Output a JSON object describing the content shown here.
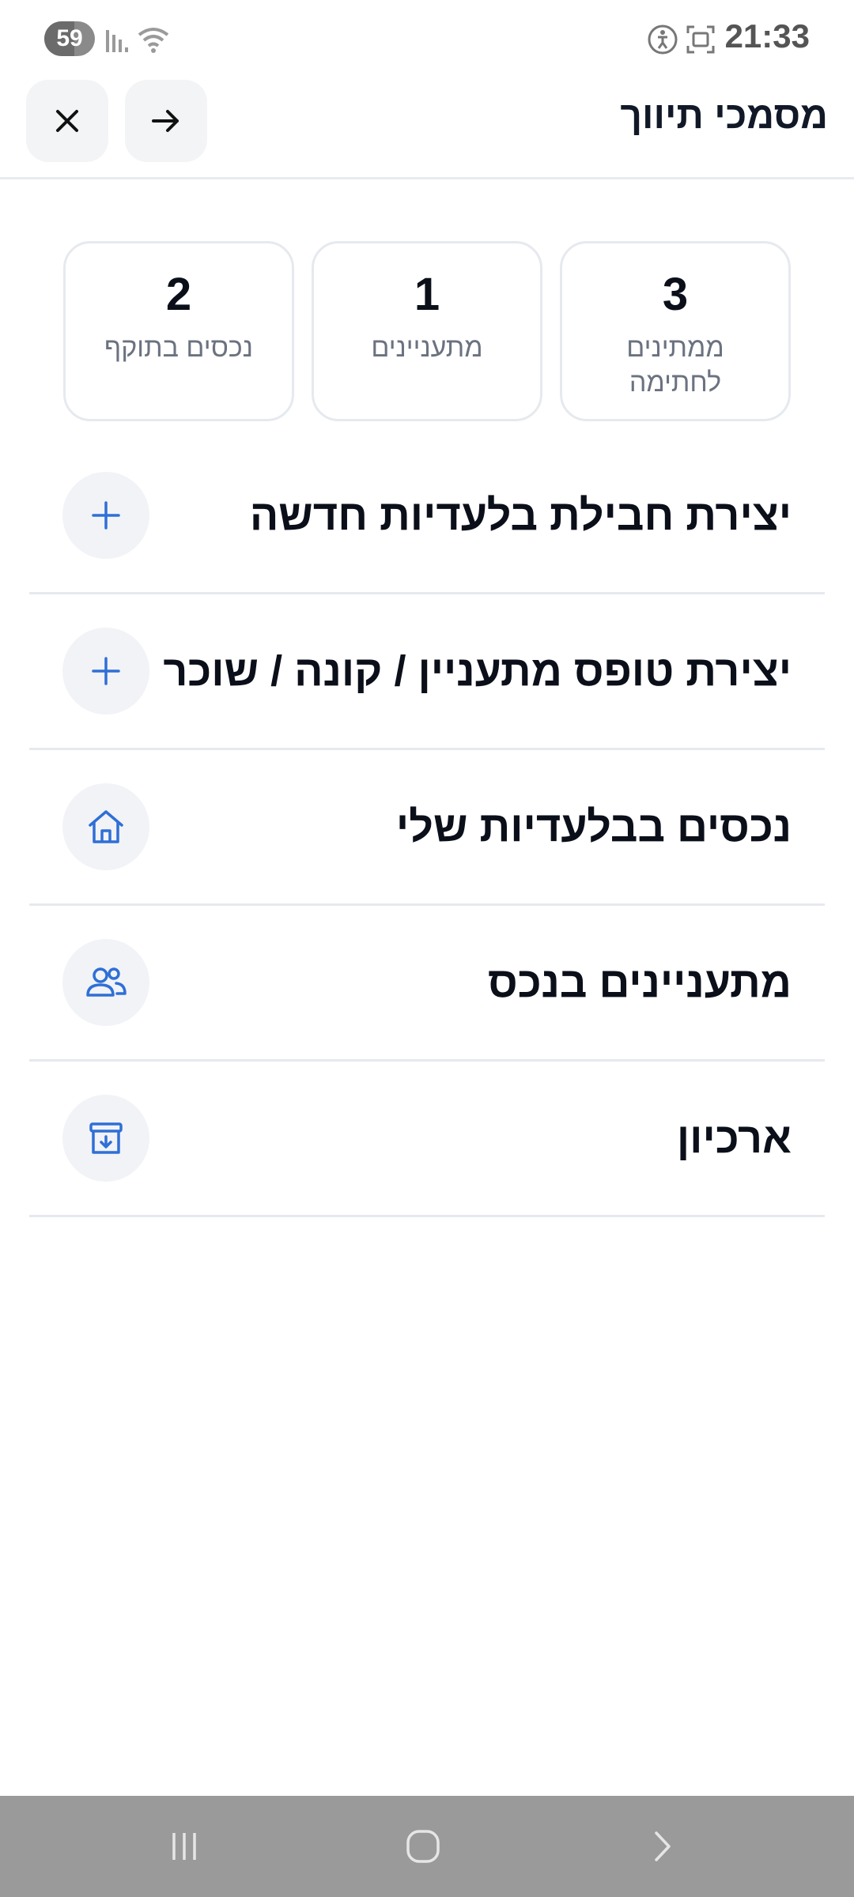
{
  "status_bar": {
    "time": "21:33",
    "battery": "59",
    "icons": [
      "signal-icon",
      "wifi-icon",
      "accessibility-icon",
      "screenshot-icon"
    ]
  },
  "header": {
    "title": "מסמכי תיווך",
    "back_icon": "arrow-right-icon",
    "close_icon": "close-icon"
  },
  "stats": [
    {
      "value": "3",
      "label": "ממתינים לחתימה"
    },
    {
      "value": "1",
      "label": "מתעניינים"
    },
    {
      "value": "2",
      "label": "נכסים בתוקף"
    }
  ],
  "menu": [
    {
      "label": "יצירת חבילת בלעדיות חדשה",
      "icon": "plus-icon"
    },
    {
      "label": "יצירת טופס מתעניין / קונה / שוכר",
      "icon": "plus-icon"
    },
    {
      "label": "נכסים בבלעדיות שלי",
      "icon": "home-icon"
    },
    {
      "label": "מתעניינים בנכס",
      "icon": "users-icon"
    },
    {
      "label": "ארכיון",
      "icon": "archive-icon"
    }
  ],
  "colors": {
    "accent": "#2f6fd6",
    "card_border": "#e6e9ee",
    "icon_bg": "#f1f3f6"
  }
}
